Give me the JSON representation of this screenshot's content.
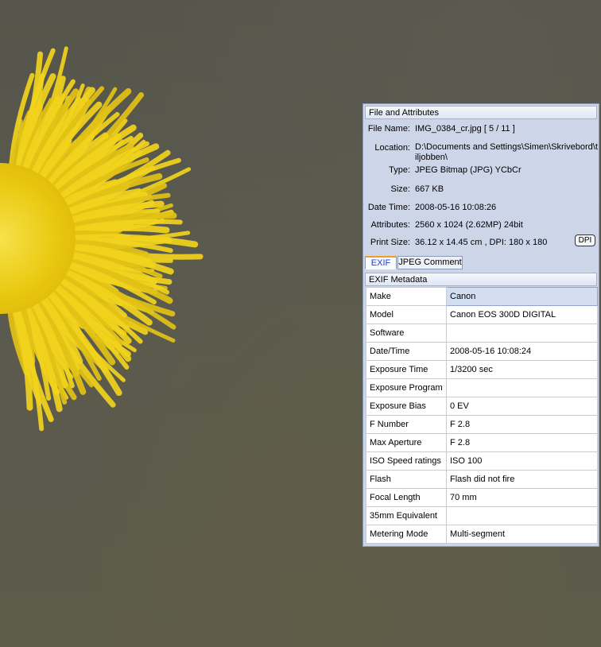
{
  "file_attributes": {
    "header": "File and Attributes",
    "rows": [
      {
        "label": "File Name:",
        "value": "IMG_0384_cr.jpg   [ 5 / 11 ]"
      },
      {
        "label": "Location:",
        "value": "D:\\Documents and Settings\\Simen\\Skrivebord\\tiljobben\\"
      },
      {
        "label": "Type:",
        "value": "JPEG Bitmap (JPG) YCbCr"
      },
      {
        "label": "Size:",
        "value": "667 KB"
      },
      {
        "label": "Date Time:",
        "value": "2008-05-16 10:08:26"
      },
      {
        "label": "Attributes:",
        "value": "2560 x 1024 (2.62MP)   24bit"
      },
      {
        "label": "Print Size:",
        "value": "36.12 x 14.45 cm ,   DPI: 180 x 180"
      }
    ],
    "dpi_button": "DPI"
  },
  "tabs": [
    {
      "label": "EXIF",
      "active": true
    },
    {
      "label": "JPEG Comment",
      "active": false
    }
  ],
  "exif": {
    "header": "EXIF Metadata",
    "rows": [
      {
        "key": "Make",
        "value": "Canon"
      },
      {
        "key": "Model",
        "value": "Canon EOS 300D DIGITAL"
      },
      {
        "key": "Software",
        "value": ""
      },
      {
        "key": "Date/Time",
        "value": "2008-05-16 10:08:24"
      },
      {
        "key": "Exposure Time",
        "value": "1/3200 sec"
      },
      {
        "key": "Exposure Program",
        "value": ""
      },
      {
        "key": "Exposure Bias",
        "value": "0 EV"
      },
      {
        "key": "F Number",
        "value": "F 2.8"
      },
      {
        "key": "Max Aperture",
        "value": "F 2.8"
      },
      {
        "key": "ISO Speed ratings",
        "value": "ISO 100"
      },
      {
        "key": "Flash",
        "value": "Flash did not fire"
      },
      {
        "key": "Focal Length",
        "value": "70 mm"
      },
      {
        "key": "35mm Equivalent",
        "value": ""
      },
      {
        "key": "Metering Mode",
        "value": "Multi-segment"
      }
    ]
  },
  "colors": {
    "panel_bg": "#cdd6e8",
    "active_tab_text": "#1a3fcc",
    "selected_cell_bg": "#d4def2",
    "flower_yellow": "#f2d21c"
  }
}
